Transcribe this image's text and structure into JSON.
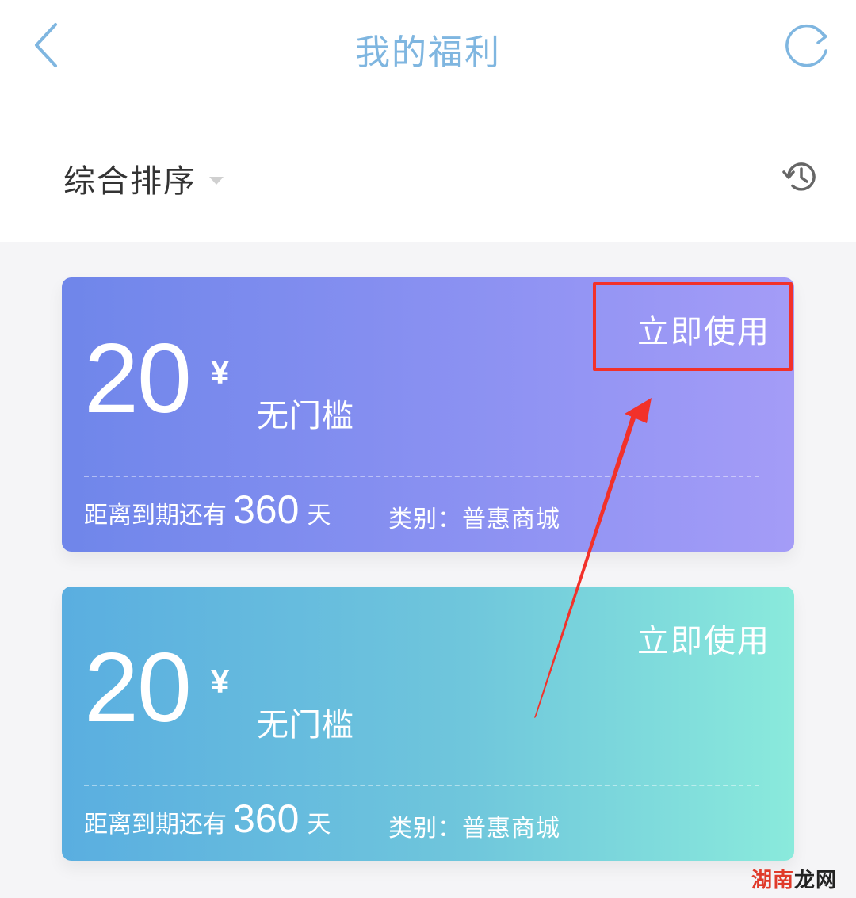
{
  "header": {
    "title": "我的福利",
    "back_icon": "chevron-left-icon",
    "refresh_icon": "refresh-icon",
    "accent_color": "#7fb6e0"
  },
  "filter": {
    "sort_label": "综合排序",
    "history_icon": "history-icon"
  },
  "coupons": [
    {
      "amount": "20",
      "currency": "¥",
      "threshold": "无门槛",
      "action_label": "立即使用",
      "expiry_prefix": "距离到期还有",
      "expiry_days": "360",
      "expiry_suffix": "天",
      "category": "类别：普惠商城",
      "gradient": [
        "#6f86ea",
        "#a49cf7"
      ]
    },
    {
      "amount": "20",
      "currency": "¥",
      "threshold": "无门槛",
      "action_label": "立即使用",
      "expiry_prefix": "距离到期还有",
      "expiry_days": "360",
      "expiry_suffix": "天",
      "category": "类别：普惠商城",
      "gradient": [
        "#5aaee0",
        "#8aeadc"
      ]
    }
  ],
  "annotation": {
    "color": "#f2312a"
  },
  "watermark": {
    "part_a": "湖南",
    "part_b": "龙网"
  }
}
